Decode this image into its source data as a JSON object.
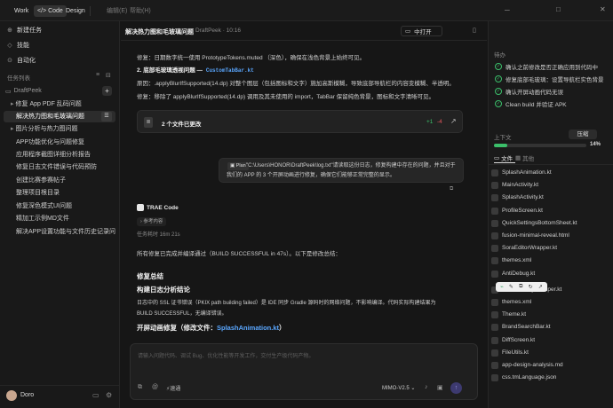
{
  "topbar": {
    "tabs": [
      "Work",
      "Code",
      "Design"
    ],
    "menus": [
      "编辑(E)",
      "帮助(H)"
    ]
  },
  "sidebar": {
    "actions": [
      "新建任务",
      "技能",
      "自动化"
    ],
    "task_list_label": "任务列表",
    "project": "DraftPeek",
    "items": [
      "修复 App PDF 乱码问题",
      "解决热力图和毛玻璃问题",
      "图片分析与热力图问题",
      "APP功能优化与问题修复",
      "应用程序截图详细分析报告",
      "修复日志文件错误与代码预防",
      "创建比赛参赛帖子",
      "整理项目根目录",
      "修复深色模式UI问题",
      "精加工示例MD文件",
      "解决APP设置功能与文件历史记录问题"
    ],
    "user": "Doro"
  },
  "header": {
    "title": "解决热力图和毛玻璃问题",
    "meta": "DraftPeek · 10:16",
    "open_label": "中打开"
  },
  "content": {
    "l1": "修复：日期数字统一使用 PrototypeTokens.muted （深色），确保在浅色背景上始终可见。",
    "l2a": "2. 底部毛玻璃透视问题 — ",
    "l2b": "CustomTabBar.kt",
    "l3": "原因：.applyBlurIfSupported(14.dp) 对整个图层（包括图标和文字）施加高斯模糊，导致底部导航栏的内容变模糊、半透明。",
    "l4": "修复：移除了 applyBlurIfSupported(14.dp) 调用及其未使用的 import，TabBar 保留纯色背景，图标和文字清晰可见。",
    "changes_label": "2 个文件已更改",
    "plus": "+1",
    "minus": "-4",
    "plan_tag": "Plan",
    "plan_text1": "\"C:\\Users\\HONOR\\DraftPeek\\log.txt\"请读取这份日志，修复构建中存在的问题，并且对于",
    "plan_text2": "我们的 APP 的 3 个开屏动画进行修复，确保它们能够正常完整的显示。",
    "agent": "TRAE Code",
    "ref": "参考内容",
    "done": "任务耗时 16m 21s",
    "summary": "所有修复已完成并编译通过（BUILD SUCCESSFUL in 47s）。以下是修改总结：",
    "h1": "修复总结",
    "h2": "构建日志分析结论",
    "p1": "日志中的 SSL 证书错误（PKIX path building failed）是 IDE 同步 Gradle 源码时的网络问题，不影响编译。代码实际构建结果为",
    "p2": "BUILD SUCCESSFUL，无编译错误。",
    "h3a": "开屏动画修复（修改文件：",
    "h3b": "SplashAnimation.kt",
    "input_placeholder": "请输入问题代码、调试 Bug、优化性能等开发工作，交付生产级代码产物。",
    "model": "MIMO-V2.5",
    "speed": "速通"
  },
  "right": {
    "todo_label": "待办",
    "todos": [
      "确认之前修改是否正确应用到代码中",
      "修复底部毛玻璃：设置导航栏实色背景",
      "确认开屏动画代码无误",
      "Clean build 并验证 APK"
    ],
    "context_label": "上下文",
    "compress": "压缩",
    "pct": "14%",
    "pct_value": 0.14,
    "tabs": [
      "文件",
      "其他"
    ],
    "files": [
      "SplashAnimation.kt",
      "MainActivity.kt",
      "SplashActivity.kt",
      "ProfileScreen.kt",
      "QuickSettingsBottomSheet.kt",
      "fusion-minimal-reveal.html",
      "SoraEditorWrapper.kt",
      "themes.xml",
      "AntiDebug.kt",
      "WebViewStyleHelper.kt",
      "themes.xml",
      "Theme.kt",
      "BrandSearchBar.kt",
      "DiffScreen.kt",
      "FileUtils.kt",
      "app-design-analysis.md",
      "css.tmLanguage.json"
    ]
  }
}
